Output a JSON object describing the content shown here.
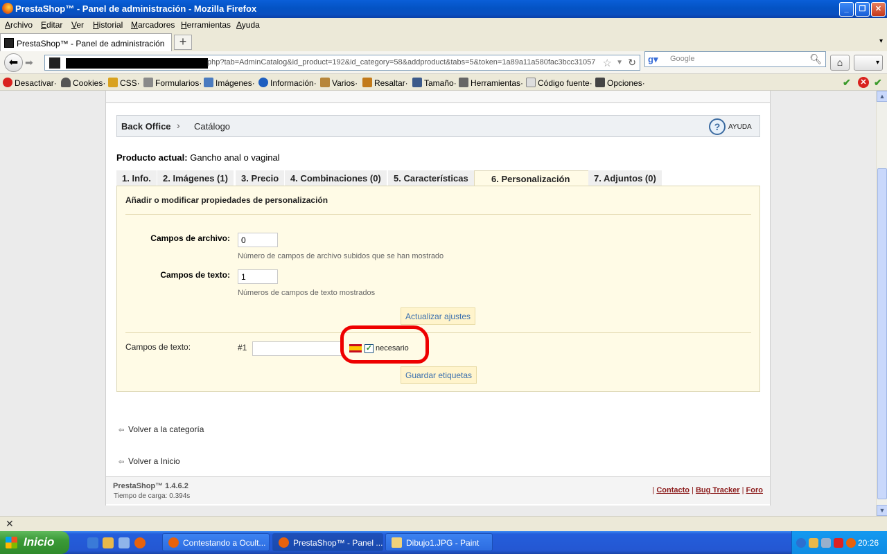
{
  "window": {
    "title": "PrestaShop™ - Panel de administración - Mozilla Firefox"
  },
  "menubar": [
    "Archivo",
    "Editar",
    "Ver",
    "Historial",
    "Marcadores",
    "Herramientas",
    "Ayuda"
  ],
  "browser_tab": {
    "title": "PrestaShop™ - Panel de administración",
    "new_tab": "+"
  },
  "nav": {
    "url": "php?tab=AdminCatalog&id_product=192&id_category=58&addproduct&tabs=5&token=1a89a11a580fac3bcc31057·",
    "search_placeholder": "Google"
  },
  "devbar": [
    "Desactivar·",
    "Cookies·",
    "CSS·",
    "Formularios·",
    "Imágenes·",
    "Información·",
    "Varios·",
    "Resaltar·",
    "Tamaño·",
    "Herramientas·",
    "Código fuente·",
    "Opciones·"
  ],
  "breadcrumb": {
    "root": "Back Office",
    "current": "Catálogo",
    "help": "AYUDA"
  },
  "product": {
    "label": "Producto actual:",
    "name": "Gancho anal o vaginal"
  },
  "tabs": [
    "1. Info.",
    "2. Imágenes (1)",
    "3. Precio",
    "4. Combinaciones (0)",
    "5. Características",
    "6. Personalización",
    "7. Adjuntos (0)"
  ],
  "active_tab": "6. Personalización",
  "panel": {
    "heading": "Añadir o modificar propiedades de personalización",
    "file_fields_label": "Campos de archivo:",
    "file_fields_value": "0",
    "file_fields_hint": "Número de campos de archivo subidos que se han mostrado",
    "text_fields_label": "Campos de texto:",
    "text_fields_value": "1",
    "text_fields_hint": "Números de campos de texto mostrados",
    "update_button": "Actualizar ajustes",
    "text_fields_row_label": "Campos de texto:",
    "field_number": "#1",
    "field_value": "",
    "required_label": "necesario",
    "required_checked": true,
    "save_button": "Guardar etiquetas"
  },
  "links": {
    "back_category": "Volver a la categoría",
    "back_home": "Volver a Inicio"
  },
  "footer": {
    "version": "PrestaShop™ 1.4.6.2",
    "load_time": "Tiempo de carga: 0.394s",
    "contact": "Contacto",
    "bug_tracker": "Bug Tracker",
    "forum": "Foro"
  },
  "taskbar": {
    "start": "Inicio",
    "items": [
      "Contestando a Ocult...",
      "PrestaShop™ - Panel ...",
      "Dibujo1.JPG - Paint"
    ],
    "clock": "20:26"
  },
  "colors": {
    "accent_red": "#ee0000",
    "panel_bg": "#fffbe6",
    "link_blue": "#3a6fae"
  }
}
